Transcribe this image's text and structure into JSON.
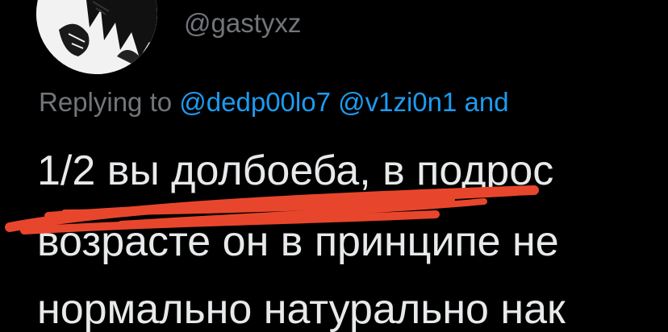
{
  "tweet": {
    "handle": "@gastyxz",
    "reply": {
      "prefix": "Replying to",
      "mentions": [
        "@dedp00lo7",
        "@v1zi0n1",
        "and"
      ]
    },
    "text_lines": [
      "1/2 вы долбоеба, в подрос",
      "возрасте он в принципе не",
      "нормально натурально нак"
    ]
  },
  "colors": {
    "background": "#000000",
    "text": "#e7e9ea",
    "muted": "#71767b",
    "link": "#1d9bf0",
    "scribble": "#e8462c"
  },
  "icons": {
    "avatar": "manga-avatar-image"
  }
}
